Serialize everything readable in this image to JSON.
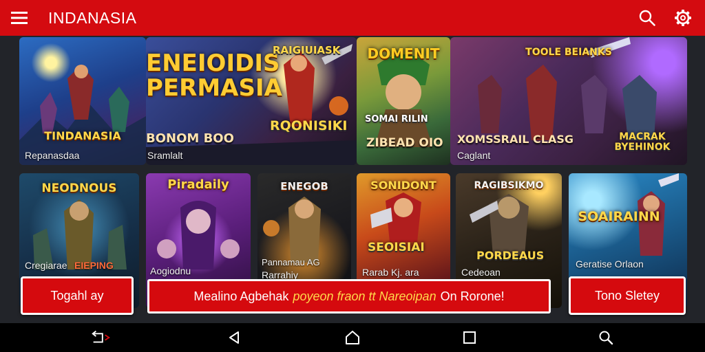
{
  "header": {
    "title": "INDANASIA",
    "menu_icon": "hamburger-menu-icon",
    "search_icon": "search-icon",
    "settings_icon": "gear-icon",
    "background": "#d40b10"
  },
  "games_row1": [
    {
      "title": "TINDANASIA",
      "subtitle": "Repanasdaa"
    },
    {
      "title": "ENEIOIDIS PERMASIA",
      "caption": "BONOM BOO",
      "subtitle": "Sramlalt"
    },
    {
      "title": "RAIGIUIASK",
      "title2": "RQONISIKI"
    },
    {
      "title": "DOMENIT",
      "caption": "ZIBEAD OIO",
      "title2": "SOMAI RILIN"
    },
    {
      "title": "TOOLE BEIANKS",
      "caption": "XOMSSRAIL CLASG",
      "subtitle": "Caglant",
      "title2": "MACRAK BYEHINOK"
    }
  ],
  "games_row2": [
    {
      "title": "NEODNOUS",
      "subtitle": "Cregiarae",
      "badge": "EIEPING"
    },
    {
      "title": "Piradaily",
      "subtitle": "Aogiodnu"
    },
    {
      "title": "ENEGOB",
      "subtitle": "Pannamau AG",
      "subtitle2": "Rarrahiy"
    },
    {
      "title": "SONIDONT",
      "title2": "SEOISIAI",
      "subtitle": "Rarab Kj. ara"
    },
    {
      "title": "RAGIBSIKMO",
      "title2": "PORDEAUS",
      "subtitle": "Cedeoan"
    },
    {
      "title": "SOAIRAINN",
      "subtitle": "Geratise Orlaon"
    }
  ],
  "bottom_bar": {
    "left_button": "Togahl ay",
    "banner_main": "Mealino Agbehak",
    "banner_italic": "poyeon fraon tt Nareoipan",
    "banner_tail": "On Rorone!",
    "right_button": "Tono Sletey",
    "accent": "#d50a0e"
  },
  "navbar": {
    "icons": [
      "rotate-back-icon",
      "back-icon",
      "home-icon",
      "recents-icon",
      "search-icon"
    ]
  }
}
